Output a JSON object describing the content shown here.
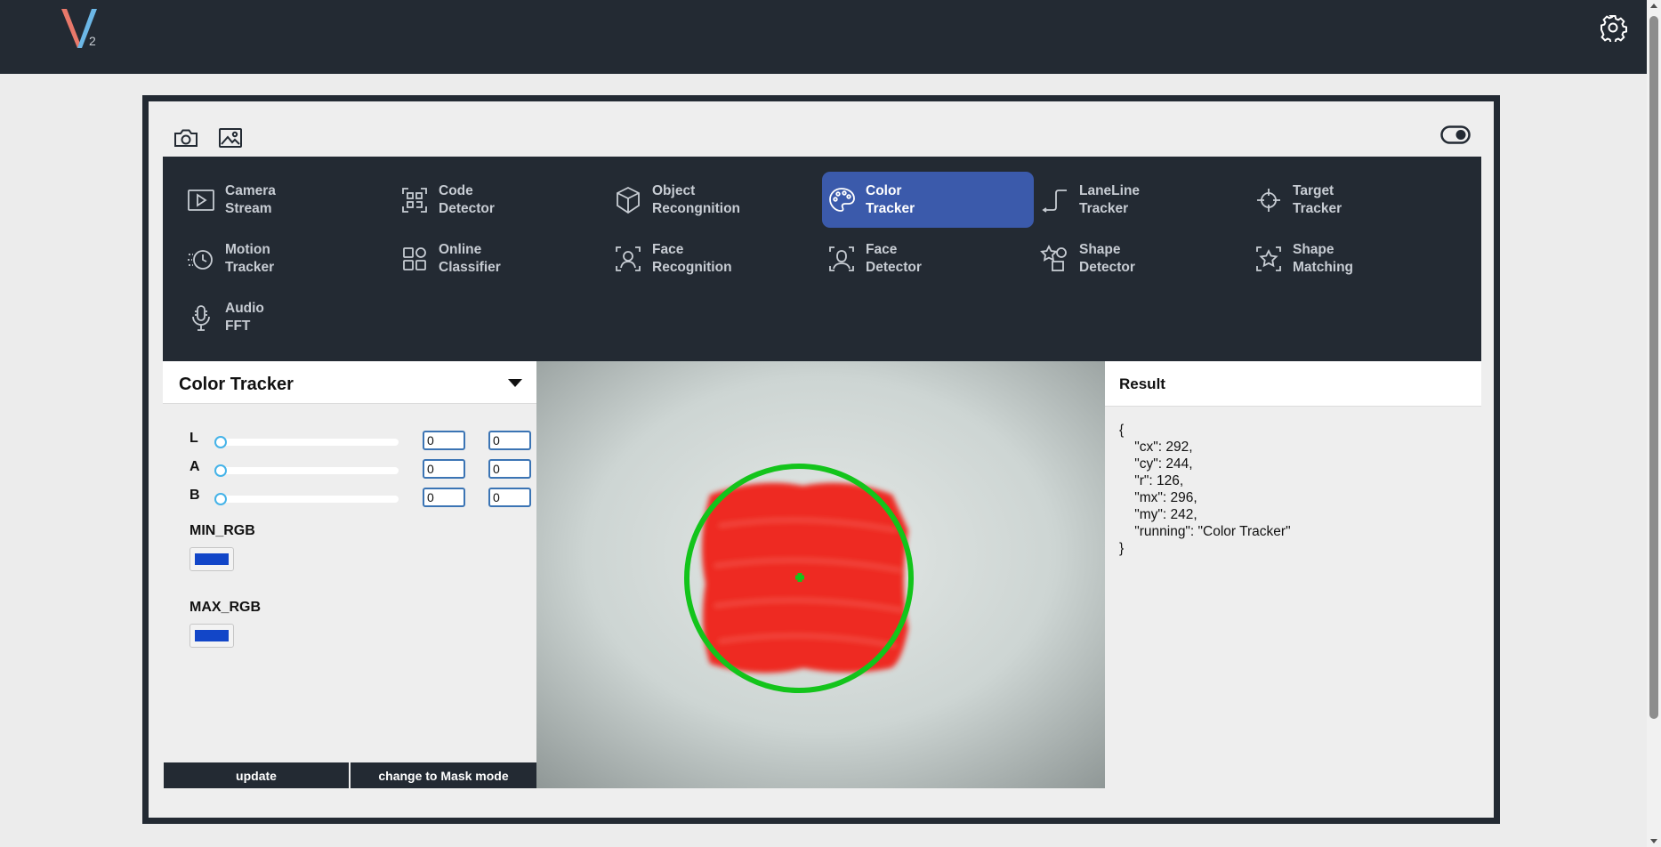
{
  "app": {
    "logo_letter": "V",
    "logo_sub": "2"
  },
  "colors": {
    "topbar": "#232a33",
    "accent": "#3b5aab",
    "swatch_min": "#1246c8",
    "swatch_max": "#1246c8",
    "tracker_circle": "#13c41b"
  },
  "toolbar": {
    "camera_icon": "camera-icon",
    "image_icon": "image-icon",
    "toggle_icon": "toggle-switch-icon"
  },
  "menu": {
    "items": [
      {
        "label": "Camera\nStream",
        "icon": "play-icon"
      },
      {
        "label": "Code\nDetector",
        "icon": "qr-code-icon"
      },
      {
        "label": "Object\nRecongnition",
        "icon": "cube-icon"
      },
      {
        "label": "Color\nTracker",
        "icon": "palette-icon",
        "active": true
      },
      {
        "label": "LaneLine\nTracker",
        "icon": "lane-icon"
      },
      {
        "label": "Target\nTracker",
        "icon": "crosshair-icon"
      },
      {
        "label": "Motion\nTracker",
        "icon": "motion-icon"
      },
      {
        "label": "Online\nClassifier",
        "icon": "grid-icon"
      },
      {
        "label": "Face\nRecognition",
        "icon": "face-recognition-icon"
      },
      {
        "label": "Face\nDetector",
        "icon": "face-detector-icon"
      },
      {
        "label": "Shape\nDetector",
        "icon": "shapes-icon"
      },
      {
        "label": "Shape\nMatching",
        "icon": "star-icon"
      },
      {
        "label": "Audio\nFFT",
        "icon": "microphone-icon"
      }
    ]
  },
  "panel": {
    "title": "Color Tracker",
    "sliders": [
      {
        "label": "L",
        "min_value": "0",
        "max_value": "0",
        "value": 0
      },
      {
        "label": "A",
        "min_value": "0",
        "max_value": "0",
        "value": 0
      },
      {
        "label": "B",
        "min_value": "0",
        "max_value": "0",
        "value": 0
      }
    ],
    "min_rgb_label": "MIN_RGB",
    "max_rgb_label": "MAX_RGB",
    "update_label": "update",
    "mask_label": "change to Mask mode"
  },
  "result": {
    "title": "Result",
    "json_text": "{\n    \"cx\": 292,\n    \"cy\": 244,\n    \"r\": 126,\n    \"mx\": 296,\n    \"my\": 242,\n    \"running\": \"Color Tracker\"\n}"
  }
}
